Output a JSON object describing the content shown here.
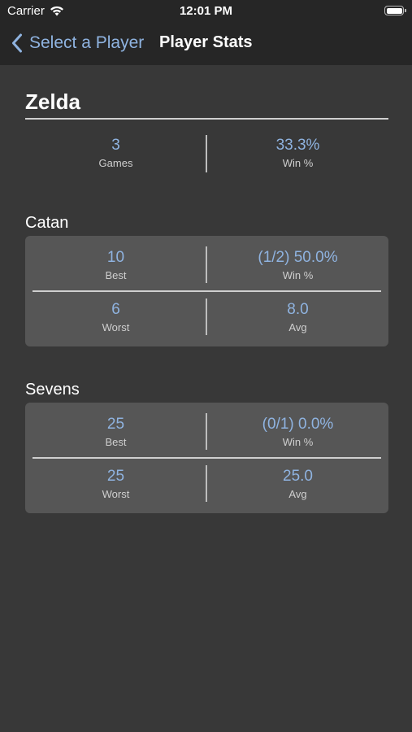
{
  "status_bar": {
    "carrier": "Carrier",
    "time": "12:01 PM"
  },
  "nav": {
    "back_label": "Select a Player",
    "title": "Player Stats"
  },
  "player": {
    "name": "Zelda",
    "games_value": "3",
    "games_label": "Games",
    "win_value": "33.3%",
    "win_label": "Win %"
  },
  "games": [
    {
      "name": "Catan",
      "best_value": "10",
      "best_label": "Best",
      "win_value": "(1/2) 50.0%",
      "win_label": "Win %",
      "worst_value": "6",
      "worst_label": "Worst",
      "avg_value": "8.0",
      "avg_label": "Avg"
    },
    {
      "name": "Sevens",
      "best_value": "25",
      "best_label": "Best",
      "win_value": "(0/1) 0.0%",
      "win_label": "Win %",
      "worst_value": "25",
      "worst_label": "Worst",
      "avg_value": "25.0",
      "avg_label": "Avg"
    }
  ],
  "colors": {
    "background": "#383838",
    "bar": "#262626",
    "card": "#565656",
    "accent": "#8fb3e0"
  }
}
